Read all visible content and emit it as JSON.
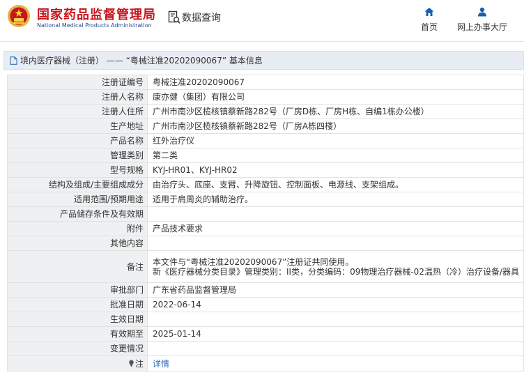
{
  "header": {
    "site_title": "国家药品监督管理局",
    "site_subtitle": "National Medical Products Administration",
    "query_label": "数据查询",
    "nav": {
      "home_label": "首页",
      "office_label": "网上办事大厅"
    }
  },
  "breadcrumb": {
    "text": "境内医疗器械（注册） —— “粤械注准20202090067” 基本信息"
  },
  "record": {
    "rows": [
      {
        "label": "注册证编号",
        "value": "粤械注准20202090067"
      },
      {
        "label": "注册人名称",
        "value": "康亦健（集团）有限公司"
      },
      {
        "label": "注册人住所",
        "value": "广州市南沙区榄核镇蔡新路282号（厂房D栋、厂房H栋、自编1栋办公楼）"
      },
      {
        "label": "生产地址",
        "value": "广州市南沙区榄核镇蔡新路282号（厂房A栋四楼）"
      },
      {
        "label": "产品名称",
        "value": "红外治疗仪"
      },
      {
        "label": "管理类别",
        "value": "第二类"
      },
      {
        "label": "型号规格",
        "value": "KYJ-HR01、KYJ-HR02"
      },
      {
        "label": "结构及组成/主要组成成分",
        "value": "由治疗头、底座、支臂、升降旋钮、控制面板、电源线、支架组成。"
      },
      {
        "label": "适用范围/预期用途",
        "value": "适用于肩周炎的辅助治疗。"
      },
      {
        "label": "产品储存条件及有效期",
        "value": ""
      },
      {
        "label": "附件",
        "value": "产品技术要求"
      },
      {
        "label": "其他内容",
        "value": ""
      },
      {
        "label": "备注",
        "value": "本文件与“粤械注准20202090067”注册证共同使用。",
        "value2": "新《医疗器械分类目录》管理类别：II类，分类编码：09物理治疗器械-02温热（冷）治疗设备/器具"
      },
      {
        "label": "审批部门",
        "value": "广东省药品监督管理局"
      },
      {
        "label": "批准日期",
        "value": "2022-06-14"
      },
      {
        "label": "生效日期",
        "value": ""
      },
      {
        "label": "有效期至",
        "value": "2025-01-14"
      },
      {
        "label": "变更情况",
        "value": ""
      }
    ],
    "note_label": "注",
    "note_link": "详情"
  },
  "colors": {
    "brand_red": "#c8161d",
    "brand_blue": "#2a4a8c",
    "nav_icon_blue": "#1d5fa8",
    "link_blue": "#2f6dbd",
    "label_bg": "#eef0f2",
    "crumb_bg": "#e7edf3"
  },
  "icons": {
    "emblem": "national-emblem-icon",
    "query": "document-search-icon",
    "home": "home-icon",
    "office": "user-icon",
    "crumb": "document-icon",
    "note": "pin-icon"
  }
}
